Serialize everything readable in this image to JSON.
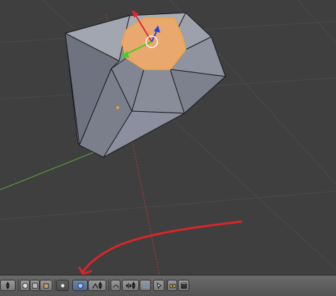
{
  "viewport": {
    "mesh_fill": "#8e93a0",
    "selected_face_fill": "#e8a86e",
    "selected_edge": "#f5a53c",
    "axis_x": "#c0393b",
    "axis_y": "#5fa83f",
    "gizmo_x": "#e0262e",
    "gizmo_y": "#40d026",
    "gizmo_z": "#2040e0",
    "annotation_arrow": "#d8262a"
  },
  "header": {
    "items": [
      "mode-selector",
      "viewport-shading-solid",
      "viewport-shading-texture",
      "viewport-shading-material",
      "pivot-point-selector",
      "transform-orientation-selector",
      "snap-toggle",
      "proportional-edit",
      "mirror-selector",
      "render-button",
      "opengl-render-button"
    ]
  }
}
